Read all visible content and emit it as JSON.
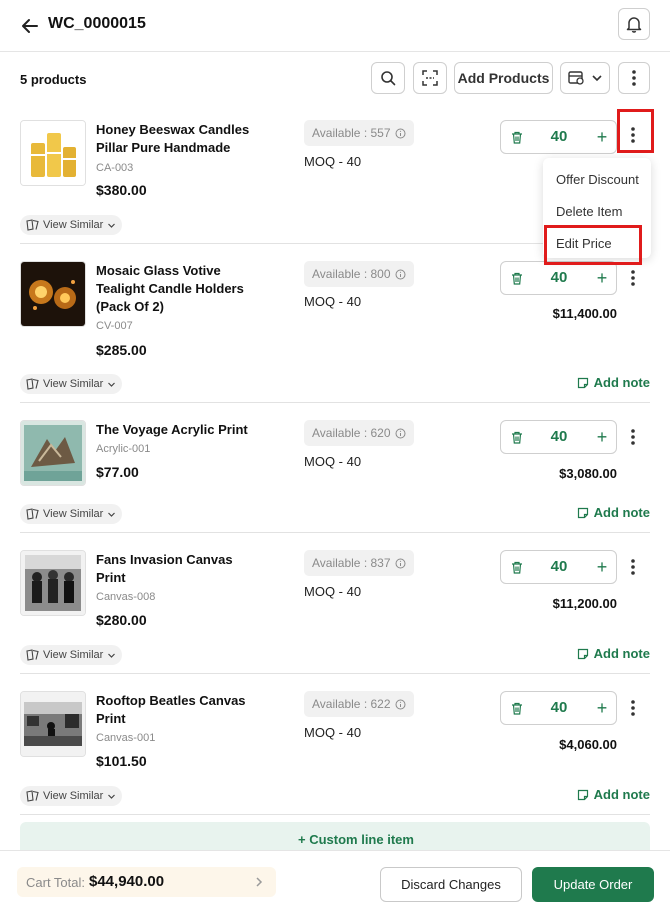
{
  "header": {
    "title": "WC_0000015",
    "back_icon": "arrow-left-icon",
    "notification_icon": "bell-icon"
  },
  "toolbar": {
    "count_label": "5 products",
    "add_products_label": "Add Products"
  },
  "products": [
    {
      "name_line1": "Honey Beeswax Candles",
      "name_line2": "Pillar Pure Handmade",
      "sku": "CA-003",
      "price": "$380.00",
      "available": "Available : 557",
      "moq": "MOQ - 40",
      "qty": "40"
    },
    {
      "name_line1": "Mosaic Glass Votive",
      "name_line2": "Tealight Candle Holders",
      "name_line3": "(Pack Of 2)",
      "sku": "CV-007",
      "price": "$285.00",
      "available": "Available : 800",
      "moq": "MOQ - 40",
      "qty": "40",
      "total": "$11,400.00"
    },
    {
      "name_line1": "The Voyage Acrylic Print",
      "sku": "Acrylic-001",
      "price": "$77.00",
      "available": "Available : 620",
      "moq": "MOQ - 40",
      "qty": "40",
      "total": "$3,080.00"
    },
    {
      "name_line1": "Fans Invasion Canvas",
      "name_line2": "Print",
      "sku": "Canvas-008",
      "price": "$280.00",
      "available": "Available : 837",
      "moq": "MOQ - 40",
      "qty": "40",
      "total": "$11,200.00"
    },
    {
      "name_line1": "Rooftop Beatles Canvas",
      "name_line2": "Print",
      "sku": "Canvas-001",
      "price": "$101.50",
      "available": "Available : 622",
      "moq": "MOQ - 40",
      "qty": "40",
      "total": "$4,060.00"
    }
  ],
  "view_similar_label": "View Similar",
  "add_note_label": "Add note",
  "row_menu": {
    "items": [
      "Offer Discount",
      "Delete Item",
      "Edit Price"
    ]
  },
  "custom_line_label": "+ Custom line item",
  "footer": {
    "cart_total_label": "Cart Total:",
    "cart_total_value": "$44,940.00",
    "discard_label": "Discard Changes",
    "update_label": "Update Order"
  },
  "colors": {
    "accent_green": "#1f7a4d",
    "highlight_red": "#e01b1b",
    "cart_bg": "#fdf6ea"
  }
}
